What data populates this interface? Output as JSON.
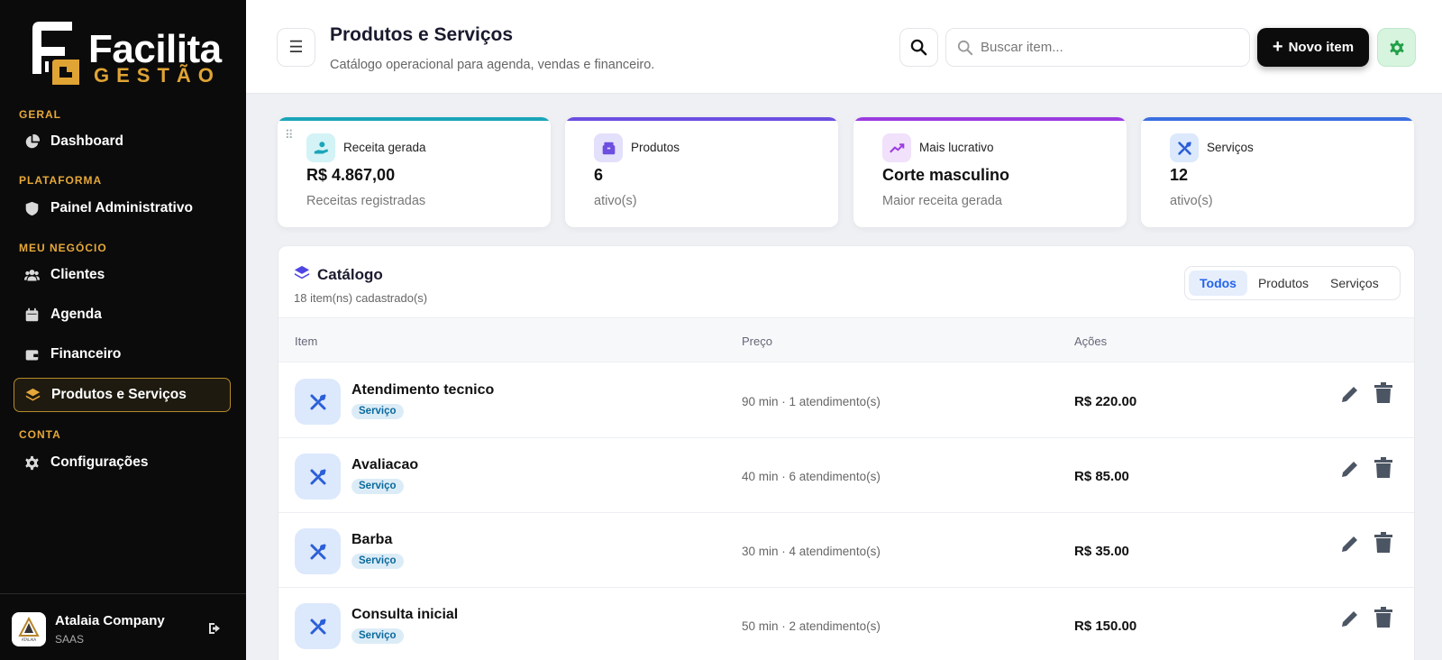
{
  "sidebar": {
    "brand_name": "Facilita",
    "brand_tag": "GESTÃO",
    "sections": [
      {
        "title": "GERAL"
      },
      {
        "title": "PLATAFORMA"
      },
      {
        "title": "MEU NEGÓCIO"
      },
      {
        "title": "CONTA"
      }
    ],
    "items": [
      {
        "label": "Dashboard",
        "icon": "pie-chart-icon"
      },
      {
        "label": "Painel Administrativo",
        "icon": "shield-icon"
      },
      {
        "label": "Clientes",
        "icon": "users-icon"
      },
      {
        "label": "Agenda",
        "icon": "calendar-icon"
      },
      {
        "label": "Financeiro",
        "icon": "wallet-icon"
      },
      {
        "label": "Produtos e Serviços",
        "icon": "layers-icon",
        "active": true
      },
      {
        "label": "Configurações",
        "icon": "gear-icon"
      }
    ],
    "user": {
      "name": "Atalaia Company",
      "role": "SAAS",
      "avatar_text": "ATALAIA"
    }
  },
  "header": {
    "title": "Produtos e Serviços",
    "subtitle": "Catálogo operacional para agenda, vendas e financeiro.",
    "menu_glyph": "☰",
    "search_placeholder": "Buscar item...",
    "new_button_plus": "+",
    "new_button": "Novo item"
  },
  "stats": [
    {
      "label": "Receita gerada",
      "value": "R$ 4.867,00",
      "caption": "Receitas registradas",
      "color": "#1aa5b8",
      "icon": "hand-money-icon"
    },
    {
      "label": "Produtos",
      "value": "6",
      "caption": "ativo(s)",
      "color": "#6c4ee0",
      "icon": "box-icon"
    },
    {
      "label": "Mais lucrativo",
      "value": "Corte masculino",
      "caption": "Maior receita gerada",
      "color": "#9b3be0",
      "icon": "trend-up-icon"
    },
    {
      "label": "Serviços",
      "value": "12",
      "caption": "ativo(s)",
      "color": "#3b6ee0",
      "icon": "tools-icon"
    }
  ],
  "drag_glyph": "⠿",
  "catalog": {
    "title": "Catálogo",
    "subtitle": "18 item(ns) cadastrado(s)",
    "filters": [
      "Todos",
      "Produtos",
      "Serviços"
    ],
    "active_filter": "Todos",
    "columns": [
      "Item",
      "Preço",
      "Ações"
    ],
    "rows": [
      {
        "name": "Atendimento tecnico",
        "type": "Serviço",
        "detail": "90 min · 1 atendimento(s)",
        "price": "R$ 220.00"
      },
      {
        "name": "Avaliacao",
        "type": "Serviço",
        "detail": "40 min · 6 atendimento(s)",
        "price": "R$ 85.00"
      },
      {
        "name": "Barba",
        "type": "Serviço",
        "detail": "30 min · 4 atendimento(s)",
        "price": "R$ 35.00"
      },
      {
        "name": "Consulta inicial",
        "type": "Serviço",
        "detail": "50 min · 2 atendimento(s)",
        "price": "R$ 150.00"
      }
    ]
  },
  "colors": {
    "accent": "#e6a83a",
    "primary": "#2563eb",
    "sidebar": "#0b0b0b"
  }
}
